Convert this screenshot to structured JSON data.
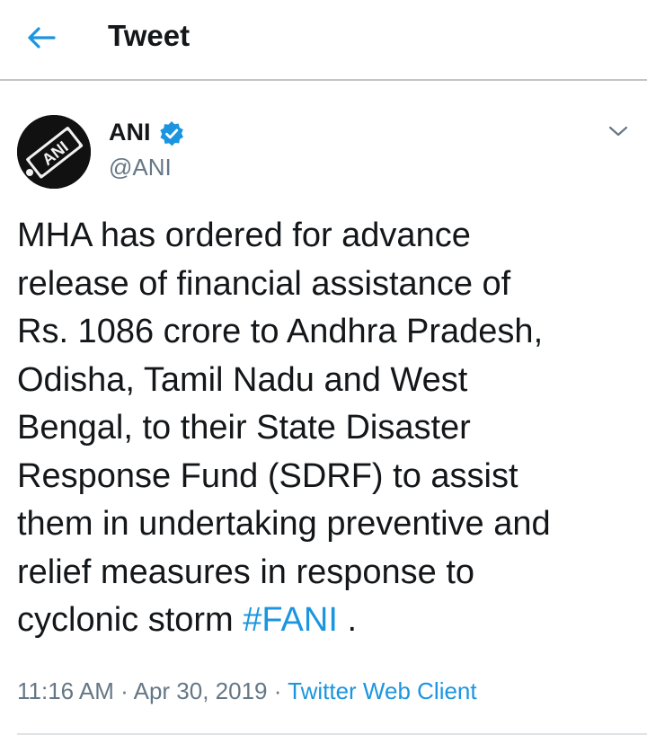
{
  "header": {
    "title": "Tweet",
    "back_icon": "arrow-left-icon"
  },
  "tweet": {
    "author": {
      "name": "ANI",
      "handle": "@ANI",
      "verified": true,
      "avatar_logo_text": "ANI"
    },
    "text_lines": [
      "MHA has ordered for advance",
      "release of financial assistance of",
      "Rs. 1086 crore to Andhra Pradesh,",
      "Odisha, Tamil Nadu and West",
      "Bengal, to their State Disaster",
      "Response Fund (SDRF) to assist",
      "them in undertaking preventive and",
      "relief measures in response to"
    ],
    "last_line_prefix": "cyclonic storm ",
    "hashtag": "#FANI",
    "last_line_suffix": " .",
    "time": "11:16 AM",
    "separator": " · ",
    "date": "Apr 30, 2019",
    "client": "Twitter Web Client"
  },
  "colors": {
    "accent": "#1b95e0",
    "text": "#14171a",
    "secondary_text": "#657786",
    "divider": "#c4c4c4"
  }
}
